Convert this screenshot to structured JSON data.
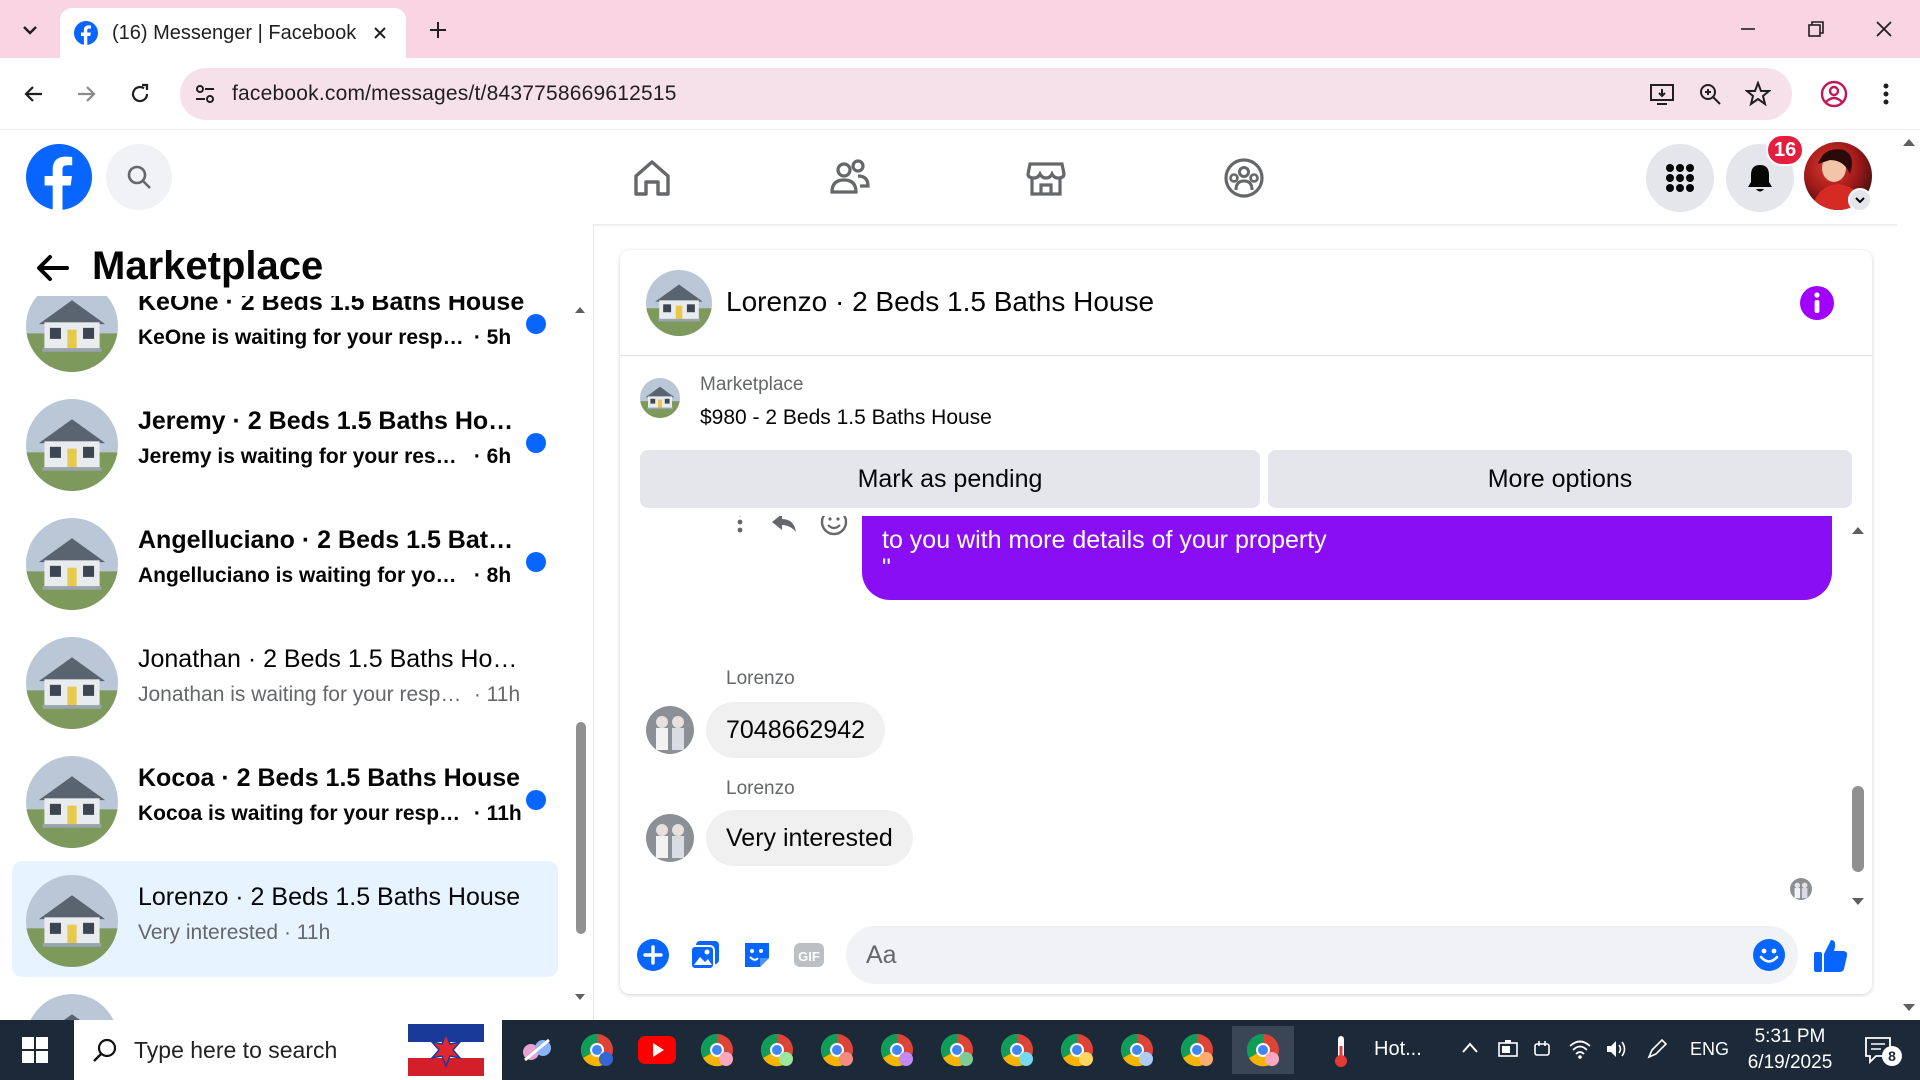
{
  "browser": {
    "tab_title": "(16) Messenger | Facebook",
    "url": "facebook.com/messages/t/8437758669612515"
  },
  "fb_header": {
    "notification_count": "16"
  },
  "sidebar": {
    "title": "Marketplace",
    "conversations": [
      {
        "name": "KeOne · 2 Beds 1.5 Baths House",
        "preview": "KeOne is waiting for your respo...",
        "time": "· 5h",
        "unread": true
      },
      {
        "name": "Jeremy · 2 Beds 1.5 Baths House",
        "preview": "Jeremy is waiting for your respo...",
        "time": "· 6h",
        "unread": true
      },
      {
        "name": "Angelluciano · 2 Beds 1.5 Baths...",
        "preview": "Angelluciano is waiting for your...",
        "time": "· 8h",
        "unread": true
      },
      {
        "name": "Jonathan · 2 Beds 1.5 Baths House",
        "preview": "Jonathan is waiting for your respo...",
        "time": "· 11h",
        "unread": false
      },
      {
        "name": "Kocoa · 2 Beds 1.5 Baths House",
        "preview": "Kocoa is waiting for your respo...",
        "time": "· 11h",
        "unread": true
      },
      {
        "name": "Lorenzo · 2 Beds 1.5 Baths House",
        "preview": "Very interested",
        "time": "· 11h",
        "unread": false,
        "active": true
      }
    ]
  },
  "chat": {
    "title": "Lorenzo · 2 Beds 1.5 Baths House",
    "listing": {
      "source": "Marketplace",
      "price_title": "$980 - 2 Beds 1.5 Baths House",
      "pending_label": "Mark as pending",
      "more_label": "More options"
    },
    "messages": {
      "outgoing_line": "to you with more details of your property",
      "outgoing_quote": "\"",
      "incoming": [
        {
          "sender": "Lorenzo",
          "text": "7048662942"
        },
        {
          "sender": "Lorenzo",
          "text": "Very interested"
        }
      ]
    },
    "composer": {
      "placeholder": "Aa"
    }
  },
  "taskbar": {
    "search_placeholder": "Type here to search",
    "weather_text": "Hot...",
    "language": "ENG",
    "time": "5:31 PM",
    "date": "6/19/2025",
    "notification_count": "8"
  },
  "colors": {
    "fb_blue": "#0866ff",
    "messenger_purple": "#8a0ef4",
    "tab_bar_pink": "#f9d4e3",
    "taskbar": "#1c2939"
  }
}
